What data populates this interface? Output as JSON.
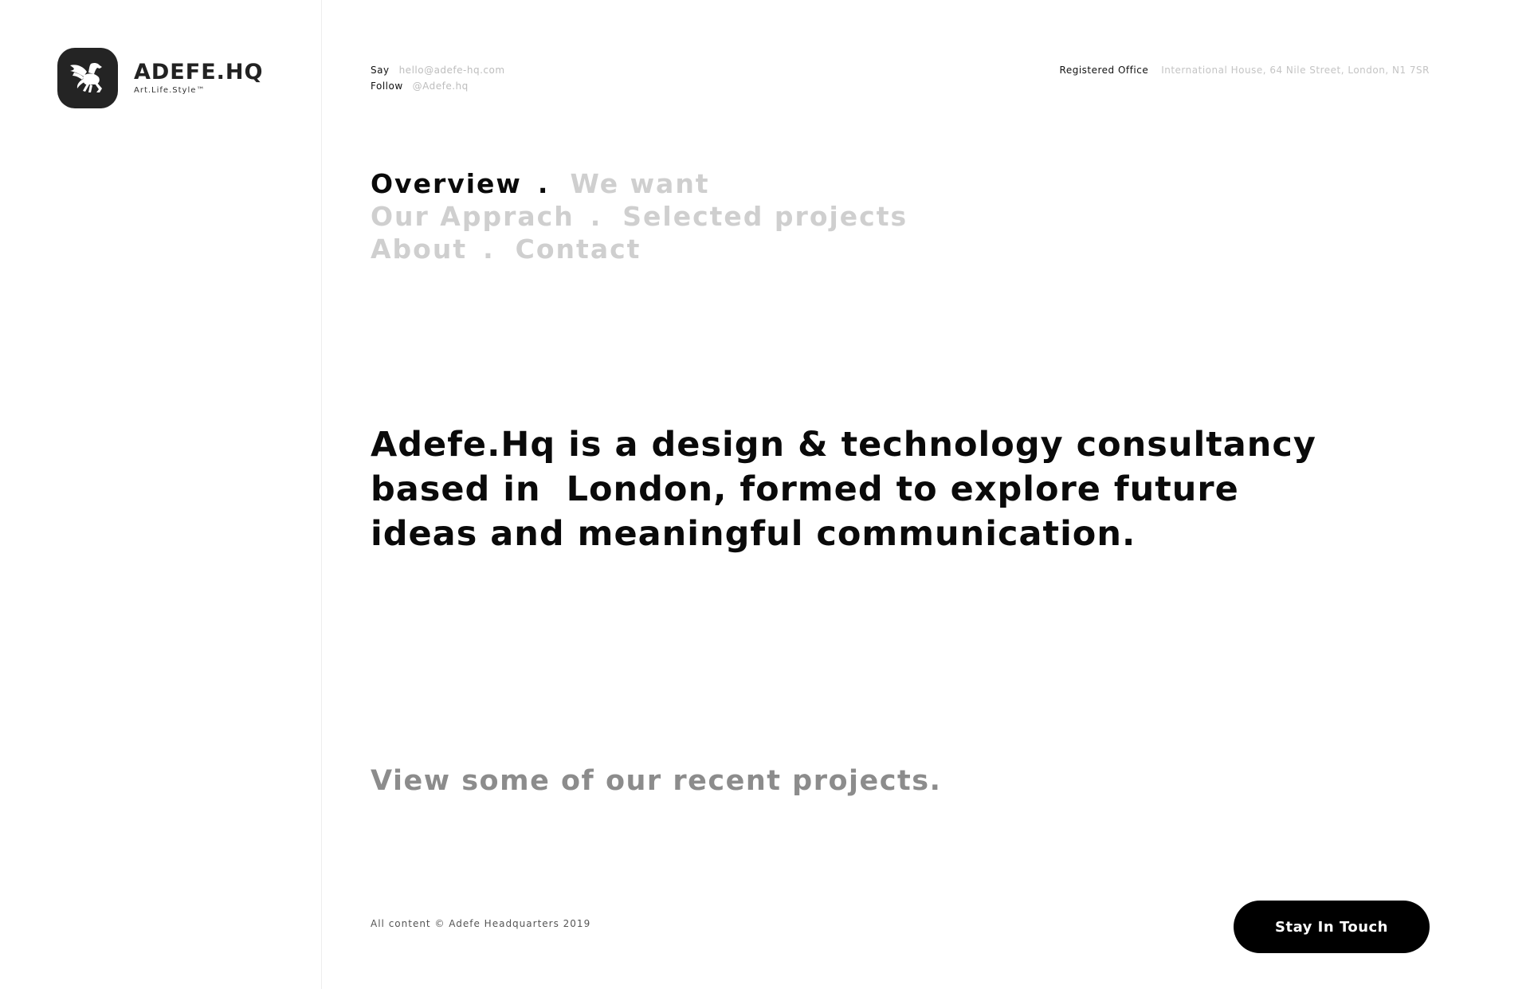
{
  "brand": {
    "name": "ADEFE.HQ",
    "tagline": "Art.Life.Style™",
    "logo_icon": "pegasus-icon"
  },
  "contact": {
    "say_label": "Say",
    "email": "hello@adefe-hq.com",
    "follow_label": "Follow",
    "handle": "@Adefe.hq"
  },
  "office": {
    "label": "Registered Office",
    "address": "International House, 64 Nile Street, London, N1 7SR"
  },
  "nav": {
    "separator": ".",
    "items": [
      {
        "label": "Overview",
        "active": true
      },
      {
        "label": "We want",
        "active": false
      },
      {
        "label": "Our Apprach",
        "active": false
      },
      {
        "label": "Selected projects",
        "active": false
      },
      {
        "label": "About",
        "active": false
      },
      {
        "label": "Contact",
        "active": false
      }
    ]
  },
  "hero": {
    "line1": "Adefe.Hq is a design & technology consultancy",
    "line2": "based in  London, formed to explore future",
    "line3": "ideas and meaningful communication."
  },
  "recent_link": "View some of our recent projects.",
  "footer": {
    "copyright": "All content © Adefe Headquarters 2019",
    "cta_label": "Stay In Touch"
  },
  "colors": {
    "text_primary": "#0a0a0a",
    "text_muted": "#cfcfcf",
    "recent_gray": "#8c8c8c",
    "logo_bg": "#242424",
    "cta_bg": "#000000"
  }
}
